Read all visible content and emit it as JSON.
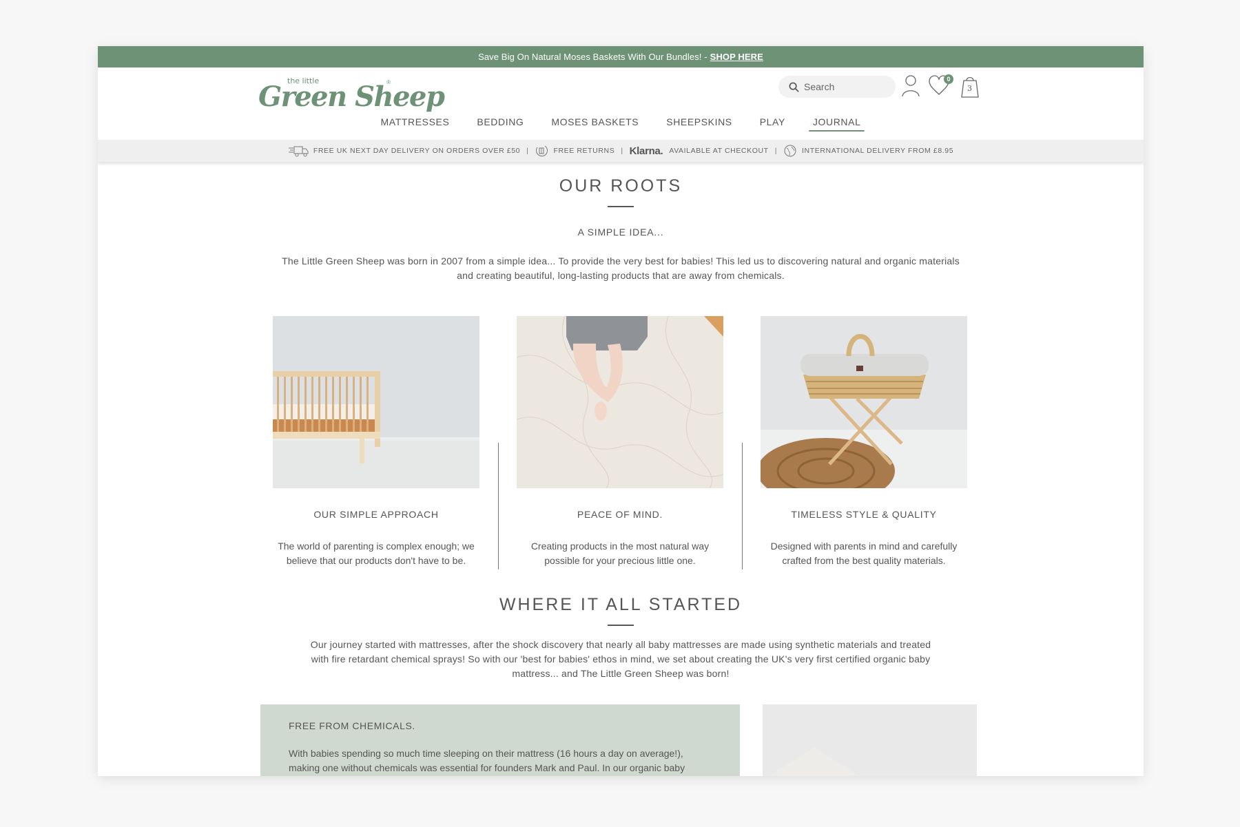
{
  "promo": {
    "text": "Save Big On Natural Moses Baskets With Our Bundles! -",
    "link": "SHOP HERE"
  },
  "brand": {
    "small": "the little",
    "name": "Green Sheep",
    "reg": "®",
    "color": "#6e9276"
  },
  "header": {
    "search_placeholder": "Search",
    "wishlist_count": "0",
    "bag_count": "3"
  },
  "nav": {
    "items": [
      {
        "label": "MATTRESSES"
      },
      {
        "label": "BEDDING"
      },
      {
        "label": "MOSES BASKETS"
      },
      {
        "label": "SHEEPSKINS"
      },
      {
        "label": "PLAY"
      },
      {
        "label": "JOURNAL",
        "active": true
      }
    ]
  },
  "infobar": {
    "delivery": "FREE UK NEXT DAY DELIVERY ON ORDERS OVER £50",
    "returns": "FREE RETURNS",
    "klarna_logo": "Klarna.",
    "klarna_text": "AVAILABLE AT CHECKOUT",
    "international": "INTERNATIONAL DELIVERY FROM £8.95",
    "separator": "|"
  },
  "roots": {
    "title": "OUR ROOTS",
    "subtitle": "A SIMPLE IDEA...",
    "paragraph_line1": "The Little Green Sheep was born in 2007 from a simple idea... To provide the very best for babies! This led us to discovering natural and organic materials",
    "paragraph_line2": "and creating beautiful, long-lasting products that are away from chemicals."
  },
  "cards": [
    {
      "image": "wooden-cot",
      "title": "OUR SIMPLE APPROACH",
      "body_line1": "The world of parenting is complex enough; we",
      "body_line2": "believe that our products don't have to be."
    },
    {
      "image": "baby-legs-on-mattress",
      "title": "PEACE OF MIND.",
      "body_line1": "Creating products in the most natural way",
      "body_line2": "possible for your precious little one."
    },
    {
      "image": "moses-basket-on-stand",
      "title": "TIMELESS STYLE & QUALITY",
      "body_line1": "Designed with parents in mind and carefully",
      "body_line2": "crafted from the best quality materials."
    }
  ],
  "started": {
    "title": "WHERE IT ALL STARTED",
    "line1": "Our journey started with mattresses, after the shock discovery that nearly all baby mattresses are made using synthetic materials and treated",
    "line2": "with fire retardant chemical sprays! So with our 'best for babies' ethos in mind, we set about creating the UK's very first certified organic baby",
    "line3": "mattress... and The Little Green Sheep was born!"
  },
  "chemicals": {
    "title": "FREE FROM CHEMICALS.",
    "line1": "With babies spending so much time sleeping on their mattress (16 hours a day on average!),",
    "line2": "making one without chemicals was essential for founders Mark and Paul. In our organic baby"
  }
}
